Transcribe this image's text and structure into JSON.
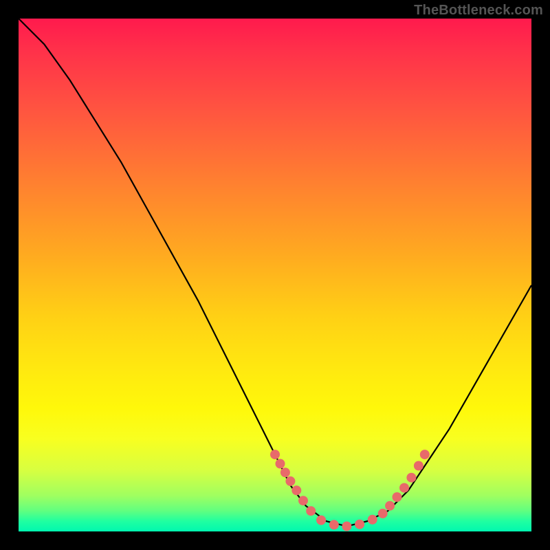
{
  "attribution": "TheBottleneck.com",
  "chart_data": {
    "type": "line",
    "title": "",
    "xlabel": "",
    "ylabel": "",
    "xlim": [
      0,
      1
    ],
    "ylim": [
      0,
      1
    ],
    "curve": [
      {
        "x": 0.0,
        "y": 1.0
      },
      {
        "x": 0.05,
        "y": 0.95
      },
      {
        "x": 0.1,
        "y": 0.88
      },
      {
        "x": 0.15,
        "y": 0.8
      },
      {
        "x": 0.2,
        "y": 0.72
      },
      {
        "x": 0.25,
        "y": 0.63
      },
      {
        "x": 0.3,
        "y": 0.54
      },
      {
        "x": 0.35,
        "y": 0.45
      },
      {
        "x": 0.4,
        "y": 0.35
      },
      {
        "x": 0.45,
        "y": 0.25
      },
      {
        "x": 0.5,
        "y": 0.15
      },
      {
        "x": 0.53,
        "y": 0.09
      },
      {
        "x": 0.56,
        "y": 0.05
      },
      {
        "x": 0.6,
        "y": 0.02
      },
      {
        "x": 0.64,
        "y": 0.01
      },
      {
        "x": 0.68,
        "y": 0.02
      },
      {
        "x": 0.72,
        "y": 0.04
      },
      {
        "x": 0.76,
        "y": 0.08
      },
      {
        "x": 0.8,
        "y": 0.14
      },
      {
        "x": 0.84,
        "y": 0.2
      },
      {
        "x": 0.88,
        "y": 0.27
      },
      {
        "x": 0.92,
        "y": 0.34
      },
      {
        "x": 0.96,
        "y": 0.41
      },
      {
        "x": 1.0,
        "y": 0.48
      }
    ],
    "dots_left": [
      {
        "x": 0.5,
        "y": 0.15
      },
      {
        "x": 0.51,
        "y": 0.132
      },
      {
        "x": 0.52,
        "y": 0.115
      },
      {
        "x": 0.53,
        "y": 0.098
      },
      {
        "x": 0.542,
        "y": 0.08
      },
      {
        "x": 0.555,
        "y": 0.06
      },
      {
        "x": 0.57,
        "y": 0.04
      }
    ],
    "dots_right": [
      {
        "x": 0.71,
        "y": 0.035
      },
      {
        "x": 0.724,
        "y": 0.05
      },
      {
        "x": 0.738,
        "y": 0.067
      },
      {
        "x": 0.752,
        "y": 0.085
      },
      {
        "x": 0.766,
        "y": 0.105
      },
      {
        "x": 0.78,
        "y": 0.128
      },
      {
        "x": 0.792,
        "y": 0.15
      }
    ],
    "dots_bottom": [
      {
        "x": 0.59,
        "y": 0.022
      },
      {
        "x": 0.615,
        "y": 0.013
      },
      {
        "x": 0.64,
        "y": 0.01
      },
      {
        "x": 0.665,
        "y": 0.014
      },
      {
        "x": 0.69,
        "y": 0.023
      }
    ],
    "curve_color": "#000000",
    "dot_color": "#e86a6a",
    "dot_radius": 7
  }
}
